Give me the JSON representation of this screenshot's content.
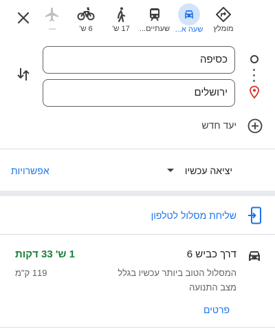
{
  "modes": [
    {
      "id": "recommended",
      "label": "מומלץ"
    },
    {
      "id": "drive",
      "label": "שעה א..."
    },
    {
      "id": "transit",
      "label": "שעתיים..."
    },
    {
      "id": "walk",
      "label": "17 ש'"
    },
    {
      "id": "bike",
      "label": "6 ש'"
    },
    {
      "id": "flight",
      "label": "—"
    }
  ],
  "origin": {
    "value": "כסיפה"
  },
  "destination": {
    "value": "ירושלים"
  },
  "add_destination_label": "יעד חדש",
  "depart": {
    "label": "יציאה עכשיו",
    "options_label": "אפשרויות"
  },
  "send": {
    "label": "שליחת מסלול לטלפון"
  },
  "route": {
    "name": "דרך כביש 6",
    "time": "1 ש' 33 דקות",
    "description": "המסלול הטוב ביותר עכשיו בגלל מצב התנועה",
    "distance": "119 ק\"מ",
    "details_label": "פרטים"
  },
  "colors": {
    "accent": "#1a73e8",
    "time_green": "#188038",
    "pin_red": "#d93025"
  }
}
